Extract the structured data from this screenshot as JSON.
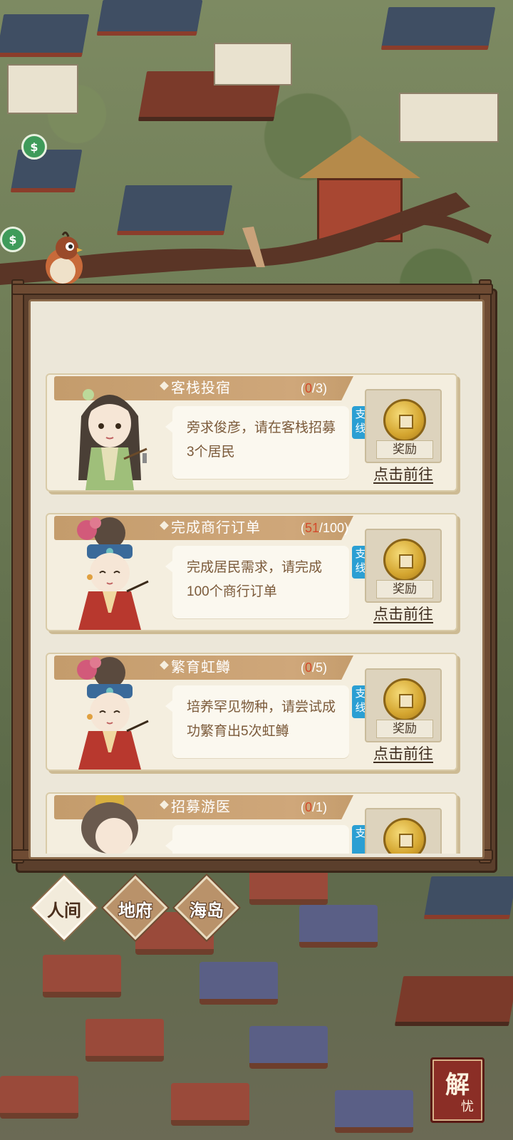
{
  "tasks": [
    {
      "title": "客栈投宿",
      "progress_current": "0",
      "progress_total": "/3)",
      "progress_open": "(",
      "description": "旁求俊彦，请在客栈招募3个居民",
      "tag": "支线",
      "reward_label": "奖励",
      "go_label": "点击前往"
    },
    {
      "title": "完成商行订单",
      "progress_current": "51",
      "progress_total": "/100)",
      "progress_open": "(",
      "description": "完成居民需求，请完成100个商行订单",
      "tag": "支线",
      "reward_label": "奖励",
      "go_label": "点击前往"
    },
    {
      "title": "繁育虹鳟",
      "progress_current": "0",
      "progress_total": "/5)",
      "progress_open": "(",
      "description": "培养罕见物种，请尝试成功繁育出5次虹鳟",
      "tag": "支线",
      "reward_label": "奖励",
      "go_label": "点击前往"
    },
    {
      "title": "招募游医",
      "progress_current": "0",
      "progress_total": "/1)",
      "progress_open": "(",
      "description": "",
      "tag": "支",
      "reward_label": "",
      "go_label": ""
    }
  ],
  "tabs": [
    {
      "label": "人间",
      "active": true
    },
    {
      "label": "地府",
      "active": false
    },
    {
      "label": "海岛",
      "active": false
    }
  ],
  "relief_button": {
    "big": "解",
    "small": "忧"
  },
  "colors": {
    "progress_current": "#d34a2b",
    "tag_bg": "#2b9fd3",
    "card_bg": "#f4eedf",
    "frame": "#5b3f2c"
  }
}
